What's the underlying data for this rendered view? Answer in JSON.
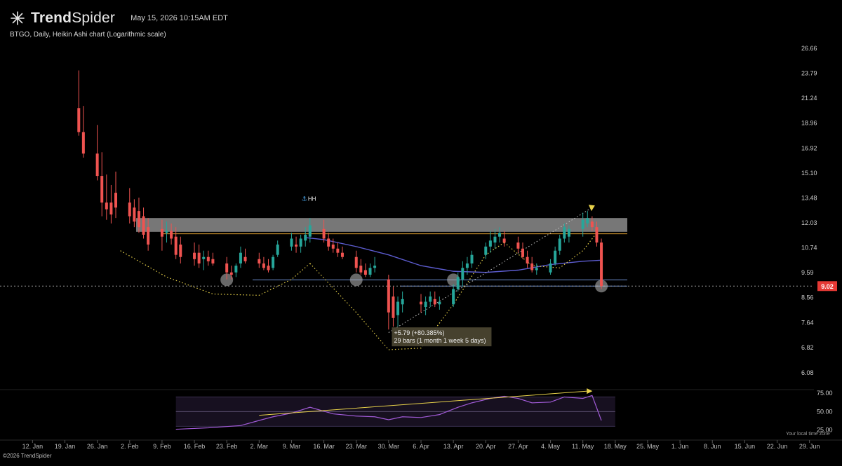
{
  "header": {
    "brand_prefix": "Trend",
    "brand_suffix": "Spider",
    "timestamp": "May 15, 2026 10:15AM EDT",
    "subtitle": "BTGO, Daily, Heikin Ashi chart (Logarithmic scale)"
  },
  "footer": {
    "copyright": "©2026 TrendSpider",
    "tz_label": "Your local time zone"
  },
  "colors": {
    "up": "#26a69a",
    "down": "#ef5350",
    "ma": "#5c5ccf",
    "fib": "#e8d24a",
    "rsi": "#a05ad6",
    "resistance": "#8c8c8c",
    "price_tag": "#e53935"
  },
  "chart_data": [
    {
      "type": "candlestick",
      "title": "BTGO, Daily, Heikin Ashi chart (Logarithmic scale)",
      "y_scale": "log",
      "ylim": [
        5.7,
        28.5
      ],
      "y_ticks": [
        26.66,
        23.79,
        21.24,
        18.96,
        16.92,
        15.1,
        13.48,
        12.03,
        10.74,
        9.59,
        8.56,
        7.64,
        6.82,
        6.08
      ],
      "x_tick_labels": [
        "12. Jan",
        "19. Jan",
        "26. Jan",
        "2. Feb",
        "9. Feb",
        "16. Feb",
        "23. Feb",
        "2. Mar",
        "9. Mar",
        "16. Mar",
        "23. Mar",
        "30. Mar",
        "6. Apr",
        "13. Apr",
        "20. Apr",
        "27. Apr",
        "4. May",
        "11. May",
        "18. May",
        "25. May",
        "1. Jun",
        "8. Jun",
        "15. Jun",
        "22. Jun",
        "29. Jun"
      ],
      "x_range": [
        "2026-01-08",
        "2026-07-03"
      ],
      "candles": [
        [
          "2026-01-22",
          20.3,
          24.1,
          17.9,
          18.2
        ],
        [
          "2026-01-23",
          18.2,
          20.5,
          16.2,
          16.5
        ],
        [
          "2026-01-26",
          16.5,
          18.8,
          14.6,
          14.9
        ],
        [
          "2026-01-27",
          14.9,
          16.6,
          12.4,
          13.2
        ],
        [
          "2026-01-28",
          13.2,
          15.0,
          12.2,
          12.8
        ],
        [
          "2026-01-29",
          13.2,
          14.3,
          12.0,
          12.5
        ],
        [
          "2026-01-30",
          13.8,
          15.2,
          12.3,
          12.9
        ],
        [
          "2026-02-02",
          13.2,
          14.1,
          12.0,
          12.4
        ],
        [
          "2026-02-03",
          12.9,
          13.4,
          11.8,
          12.1
        ],
        [
          "2026-02-04",
          12.7,
          13.5,
          11.5,
          11.8
        ],
        [
          "2026-02-05",
          12.4,
          12.9,
          11.2,
          11.4
        ],
        [
          "2026-02-06",
          11.8,
          12.3,
          10.6,
          10.9
        ],
        [
          "2026-02-09",
          11.7,
          12.2,
          10.6,
          11.3
        ],
        [
          "2026-02-10",
          11.5,
          12.1,
          11.0,
          11.6
        ],
        [
          "2026-02-11",
          11.6,
          12.0,
          10.9,
          11.2
        ],
        [
          "2026-02-12",
          11.3,
          11.8,
          10.2,
          10.4
        ],
        [
          "2026-02-13",
          10.9,
          11.3,
          10.0,
          10.3
        ],
        [
          "2026-02-16",
          10.5,
          11.0,
          9.9,
          10.2
        ],
        [
          "2026-02-17",
          10.5,
          10.9,
          9.8,
          10.0
        ],
        [
          "2026-02-18",
          10.2,
          10.6,
          9.7,
          10.3
        ],
        [
          "2026-02-19",
          10.3,
          10.6,
          9.9,
          10.1
        ],
        [
          "2026-02-20",
          10.2,
          10.5,
          9.9,
          10.0
        ],
        [
          "2026-02-23",
          10.0,
          10.3,
          9.3,
          9.6
        ],
        [
          "2026-02-24",
          9.6,
          9.9,
          9.3,
          9.5
        ],
        [
          "2026-02-25",
          9.6,
          10.0,
          9.4,
          9.9
        ],
        [
          "2026-02-26",
          10.0,
          10.8,
          9.8,
          10.5
        ],
        [
          "2026-02-27",
          10.3,
          10.7,
          10.0,
          10.1
        ],
        [
          "2026-03-02",
          10.2,
          10.5,
          9.8,
          10.0
        ],
        [
          "2026-03-03",
          10.0,
          10.3,
          9.7,
          9.8
        ],
        [
          "2026-03-04",
          9.9,
          10.2,
          9.6,
          9.7
        ],
        [
          "2026-03-05",
          9.8,
          10.4,
          9.7,
          10.3
        ],
        [
          "2026-03-06",
          10.4,
          11.1,
          10.3,
          10.9
        ],
        [
          "2026-03-09",
          10.8,
          11.5,
          10.6,
          11.2
        ],
        [
          "2026-03-10",
          10.9,
          11.3,
          10.5,
          10.8
        ],
        [
          "2026-03-11",
          10.8,
          11.4,
          10.5,
          11.2
        ],
        [
          "2026-03-12",
          11.1,
          11.8,
          10.8,
          11.4
        ],
        [
          "2026-03-13",
          11.3,
          12.3,
          11.0,
          11.9
        ],
        [
          "2026-03-16",
          11.7,
          12.2,
          11.0,
          11.2
        ],
        [
          "2026-03-17",
          11.2,
          11.5,
          10.6,
          10.8
        ],
        [
          "2026-03-18",
          10.9,
          11.2,
          10.5,
          10.7
        ],
        [
          "2026-03-19",
          10.7,
          11.0,
          10.3,
          10.5
        ],
        [
          "2026-03-20",
          10.5,
          10.8,
          10.2,
          10.3
        ],
        [
          "2026-03-23",
          10.3,
          10.6,
          9.6,
          9.8
        ],
        [
          "2026-03-24",
          9.9,
          10.2,
          9.5,
          9.6
        ],
        [
          "2026-03-25",
          9.7,
          10.0,
          9.4,
          9.5
        ],
        [
          "2026-03-26",
          9.5,
          10.0,
          9.4,
          9.8
        ],
        [
          "2026-03-27",
          9.8,
          10.3,
          9.6,
          9.9
        ],
        [
          "2026-03-30",
          9.3,
          9.5,
          7.4,
          8.0
        ],
        [
          "2026-03-31",
          8.6,
          9.0,
          7.5,
          7.8
        ],
        [
          "2026-04-01",
          7.9,
          8.6,
          7.5,
          8.4
        ],
        [
          "2026-04-02",
          8.3,
          8.8,
          8.0,
          8.5
        ],
        [
          "2026-04-06",
          8.4,
          8.7,
          8.0,
          8.3
        ],
        [
          "2026-04-07",
          8.2,
          8.6,
          7.9,
          8.4
        ],
        [
          "2026-04-08",
          8.4,
          8.8,
          8.2,
          8.6
        ],
        [
          "2026-04-09",
          8.5,
          8.8,
          8.2,
          8.3
        ],
        [
          "2026-04-10",
          8.3,
          8.6,
          8.1,
          8.4
        ],
        [
          "2026-04-13",
          8.3,
          9.1,
          8.2,
          8.9
        ],
        [
          "2026-04-14",
          8.9,
          9.6,
          8.8,
          9.4
        ],
        [
          "2026-04-15",
          9.3,
          10.1,
          9.0,
          9.8
        ],
        [
          "2026-04-16",
          9.8,
          10.3,
          9.5,
          10.0
        ],
        [
          "2026-04-17",
          10.0,
          10.6,
          9.8,
          10.4
        ],
        [
          "2026-04-20",
          10.4,
          11.0,
          10.2,
          10.8
        ],
        [
          "2026-04-21",
          10.8,
          11.6,
          10.5,
          11.1
        ],
        [
          "2026-04-22",
          11.0,
          11.7,
          10.7,
          11.3
        ],
        [
          "2026-04-23",
          11.3,
          11.8,
          11.0,
          11.5
        ],
        [
          "2026-04-24",
          11.2,
          11.6,
          10.8,
          11.0
        ],
        [
          "2026-04-27",
          11.0,
          11.3,
          10.5,
          10.7
        ],
        [
          "2026-04-28",
          10.7,
          11.0,
          10.2,
          10.3
        ],
        [
          "2026-04-29",
          10.3,
          10.6,
          9.8,
          10.0
        ],
        [
          "2026-04-30",
          10.0,
          10.3,
          9.6,
          9.7
        ],
        [
          "2026-05-01",
          9.7,
          10.0,
          9.5,
          9.8
        ],
        [
          "2026-05-04",
          9.6,
          10.2,
          9.5,
          10.0
        ],
        [
          "2026-05-05",
          10.0,
          10.8,
          9.9,
          10.6
        ],
        [
          "2026-05-06",
          10.6,
          11.4,
          10.4,
          11.2
        ],
        [
          "2026-05-07",
          11.2,
          12.0,
          11.0,
          11.8
        ],
        [
          "2026-05-08",
          11.3,
          11.9,
          11.0,
          11.7
        ],
        [
          "2026-05-11",
          11.7,
          12.6,
          11.3,
          12.2
        ],
        [
          "2026-05-12",
          12.0,
          12.7,
          11.8,
          12.3
        ],
        [
          "2026-05-13",
          12.1,
          12.4,
          11.6,
          11.8
        ],
        [
          "2026-05-14",
          11.8,
          12.1,
          10.8,
          11.0
        ],
        [
          "2026-05-15",
          11.0,
          11.2,
          8.9,
          9.02
        ]
      ],
      "ma_series": [
        [
          "2026-03-12",
          11.25
        ],
        [
          "2026-03-16",
          11.15
        ],
        [
          "2026-03-23",
          10.8
        ],
        [
          "2026-03-30",
          10.4
        ],
        [
          "2026-04-06",
          9.9
        ],
        [
          "2026-04-13",
          9.65
        ],
        [
          "2026-04-20",
          9.6
        ],
        [
          "2026-04-27",
          9.7
        ],
        [
          "2026-05-04",
          9.95
        ],
        [
          "2026-05-11",
          10.1
        ],
        [
          "2026-05-15",
          10.15
        ]
      ],
      "last_price": "9.02",
      "annotation_hh": "HH",
      "measure_label_1": "+5.79 (+80.385%)",
      "measure_label_2": "29 bars (1 month 1 week 5 days)"
    },
    {
      "type": "line",
      "series": [
        {
          "values": [
            [
              "2026-02-12",
              26
            ],
            [
              "2026-02-19",
              28
            ],
            [
              "2026-02-26",
              31
            ],
            [
              "2026-03-02",
              38
            ],
            [
              "2026-03-05",
              43
            ],
            [
              "2026-03-09",
              48
            ],
            [
              "2026-03-13",
              56
            ],
            [
              "2026-03-18",
              47
            ],
            [
              "2026-03-23",
              44
            ],
            [
              "2026-03-27",
              43
            ],
            [
              "2026-03-30",
              39
            ],
            [
              "2026-04-02",
              43
            ],
            [
              "2026-04-06",
              42
            ],
            [
              "2026-04-10",
              46
            ],
            [
              "2026-04-14",
              56
            ],
            [
              "2026-04-17",
              62
            ],
            [
              "2026-04-21",
              68
            ],
            [
              "2026-04-24",
              71
            ],
            [
              "2026-04-27",
              68
            ],
            [
              "2026-04-30",
              62
            ],
            [
              "2026-05-04",
              63
            ],
            [
              "2026-05-07",
              70
            ],
            [
              "2026-05-11",
              68
            ],
            [
              "2026-05-13",
              72
            ],
            [
              "2026-05-15",
              38
            ]
          ]
        }
      ],
      "ylim": [
        17,
        80
      ],
      "y_ticks": [
        75.0,
        50.0,
        25.0
      ],
      "band": [
        30,
        70
      ]
    }
  ]
}
